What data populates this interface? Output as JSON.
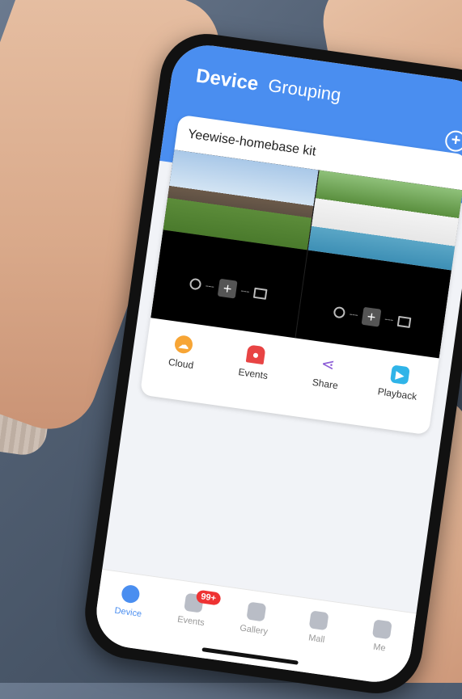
{
  "header": {
    "tabs": [
      {
        "label": "Device"
      },
      {
        "label": "Grouping"
      }
    ],
    "add_icon": "plus-circle-icon"
  },
  "device_card": {
    "title": "Yeewise-homebase kit",
    "menu_icon": "more-vertical-icon",
    "cameras": [
      {
        "name": "camera-1"
      },
      {
        "name": "camera-2"
      }
    ],
    "add_symbol": "+",
    "actions": [
      {
        "label": "Cloud",
        "icon": "cloud-icon",
        "symbol": "☁"
      },
      {
        "label": "Events",
        "icon": "siren-icon",
        "symbol": "●"
      },
      {
        "label": "Share",
        "icon": "share-icon",
        "symbol": "⋖"
      },
      {
        "label": "Playback",
        "icon": "playback-icon",
        "symbol": "▶"
      }
    ]
  },
  "bottom_nav": {
    "items": [
      {
        "label": "Device",
        "icon": "camera-icon",
        "active": true
      },
      {
        "label": "Events",
        "icon": "message-icon",
        "badge": "99+"
      },
      {
        "label": "Gallery",
        "icon": "gallery-icon"
      },
      {
        "label": "Mall",
        "icon": "cart-icon"
      },
      {
        "label": "Me",
        "icon": "user-icon"
      }
    ]
  },
  "colors": {
    "accent": "#4a8ef0",
    "badge": "#e33333"
  }
}
